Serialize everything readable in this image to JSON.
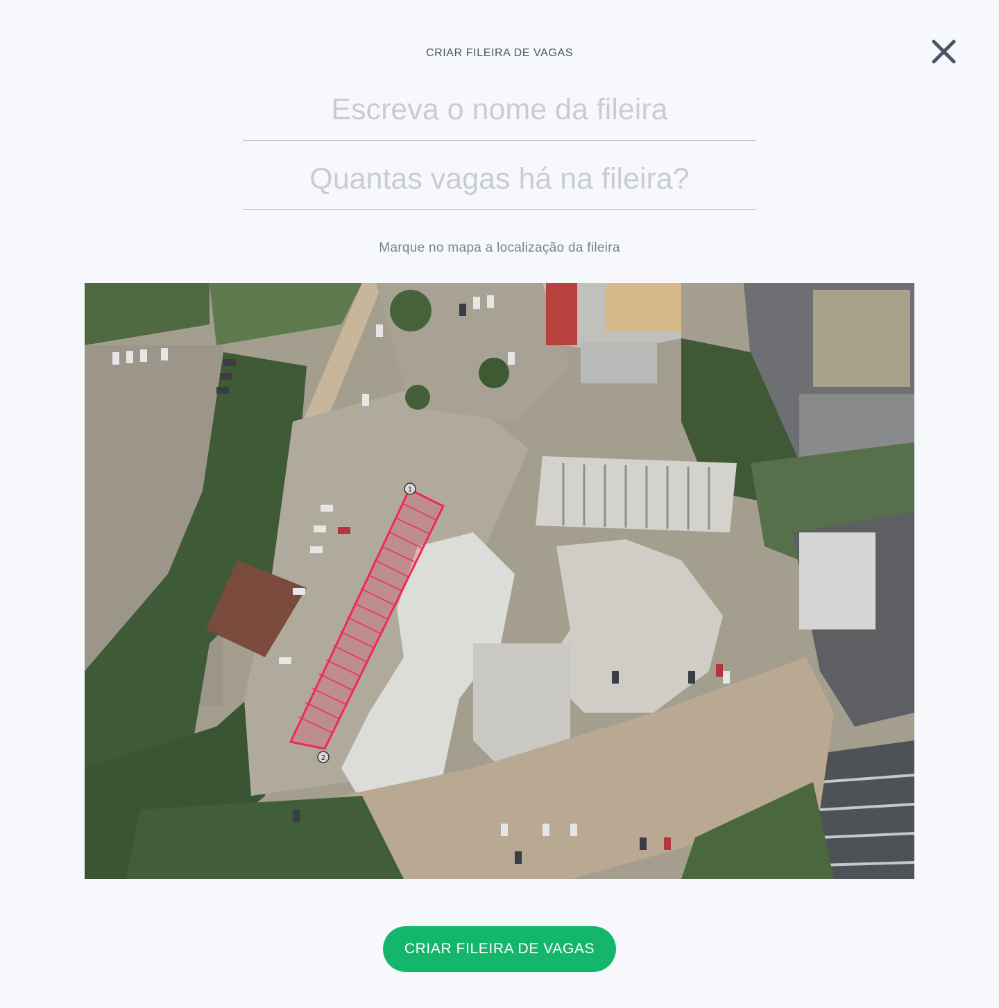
{
  "modal": {
    "title": "CRIAR FILEIRA DE VAGAS",
    "close_icon": "close-icon"
  },
  "form": {
    "row_name": {
      "value": "",
      "placeholder": "Escreva o nome da fileira"
    },
    "space_count": {
      "value": "",
      "placeholder": "Quantas vagas há na fileira?"
    },
    "instruction": "Marque no mapa a localização da fileira"
  },
  "map": {
    "view": "satellite",
    "row_markers": [
      {
        "label": "1"
      },
      {
        "label": "2"
      }
    ],
    "row_color": "#f0285a",
    "marked_spaces": 17
  },
  "submit": {
    "label": "CRIAR FILEIRA DE VAGAS",
    "color": "#14b66c"
  },
  "colors": {
    "background": "#f7f8fb",
    "title_text": "#4a5264",
    "placeholder_text": "#c9ccd5",
    "instruction_text": "#7a8194"
  }
}
